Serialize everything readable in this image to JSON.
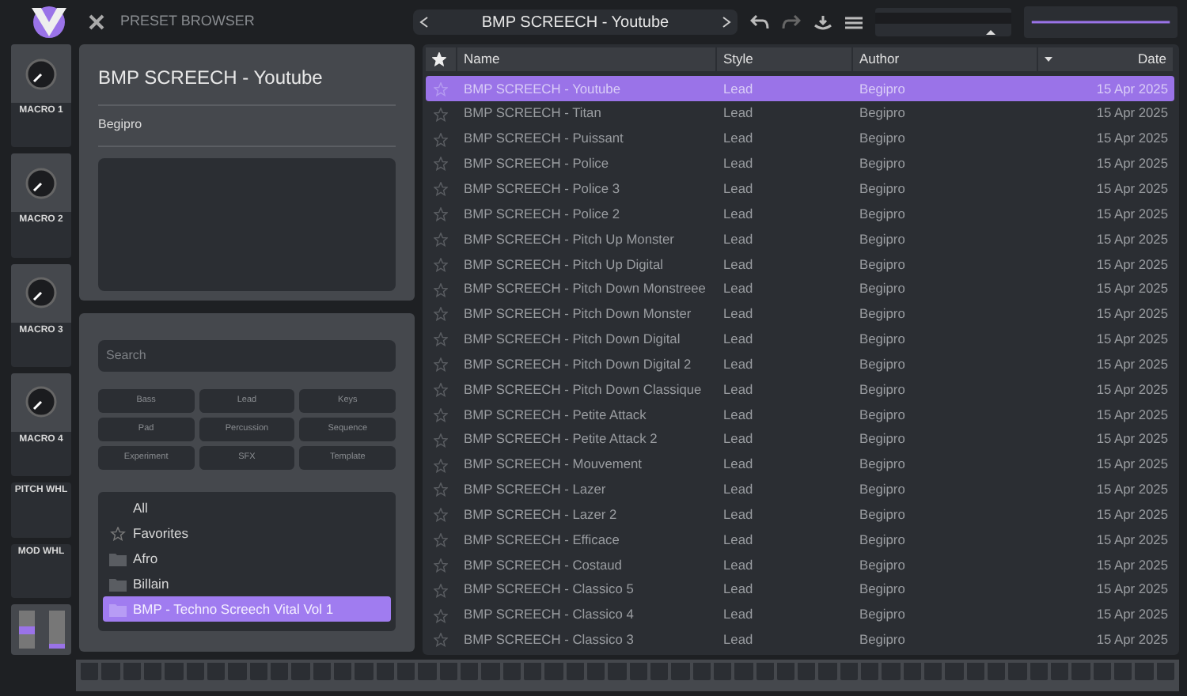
{
  "top_bar": {
    "title": "PRESET BROWSER",
    "preset_name": "BMP SCREECH - Youtube"
  },
  "macros": [
    {
      "label": "MACRO 1"
    },
    {
      "label": "MACRO 2"
    },
    {
      "label": "MACRO 3"
    },
    {
      "label": "MACRO 4"
    }
  ],
  "wheels": [
    {
      "label": "PITCH WHL"
    },
    {
      "label": "MOD WHL"
    }
  ],
  "preset_info": {
    "name": "BMP SCREECH - Youtube",
    "author": "Begipro"
  },
  "filters": {
    "search": {
      "placeholder": "Search"
    },
    "tags": [
      {
        "label": "Bass",
        "selected": false
      },
      {
        "label": "Lead",
        "selected": false
      },
      {
        "label": "Keys",
        "selected": false
      },
      {
        "label": "Pad",
        "selected": false
      },
      {
        "label": "Percussion",
        "selected": false
      },
      {
        "label": "Sequence",
        "selected": false
      },
      {
        "label": "Experiment",
        "selected": false
      },
      {
        "label": "SFX",
        "selected": false
      },
      {
        "label": "Template",
        "selected": false
      }
    ],
    "folders": [
      {
        "label": "All",
        "kind": "plain",
        "selected": false
      },
      {
        "label": "Favorites",
        "kind": "favorites",
        "selected": false
      },
      {
        "label": "Afro",
        "kind": "folder",
        "selected": false
      },
      {
        "label": "Billain",
        "kind": "folder",
        "selected": false
      },
      {
        "label": "BMP - Techno Screech Vital Vol 1",
        "kind": "folder",
        "selected": true
      }
    ]
  },
  "table": {
    "columns": [
      {
        "label": "Name",
        "sorted": false
      },
      {
        "label": "Style",
        "sorted": false
      },
      {
        "label": "Author",
        "sorted": false
      },
      {
        "label": "Date",
        "sorted": true
      }
    ],
    "rows": [
      {
        "name": "BMP SCREECH - Youtube",
        "style": "Lead",
        "author": "Begipro",
        "date": "15 Apr 2025",
        "favorite": false,
        "selected": true
      },
      {
        "name": "BMP SCREECH - Titan",
        "style": "Lead",
        "author": "Begipro",
        "date": "15 Apr 2025",
        "favorite": false,
        "selected": false
      },
      {
        "name": "BMP SCREECH - Puissant",
        "style": "Lead",
        "author": "Begipro",
        "date": "15 Apr 2025",
        "favorite": false,
        "selected": false
      },
      {
        "name": "BMP SCREECH - Police",
        "style": "Lead",
        "author": "Begipro",
        "date": "15 Apr 2025",
        "favorite": false,
        "selected": false
      },
      {
        "name": "BMP SCREECH - Police 3",
        "style": "Lead",
        "author": "Begipro",
        "date": "15 Apr 2025",
        "favorite": false,
        "selected": false
      },
      {
        "name": "BMP SCREECH - Police 2",
        "style": "Lead",
        "author": "Begipro",
        "date": "15 Apr 2025",
        "favorite": false,
        "selected": false
      },
      {
        "name": "BMP SCREECH - Pitch Up Monster",
        "style": "Lead",
        "author": "Begipro",
        "date": "15 Apr 2025",
        "favorite": false,
        "selected": false
      },
      {
        "name": "BMP SCREECH - Pitch Up Digital",
        "style": "Lead",
        "author": "Begipro",
        "date": "15 Apr 2025",
        "favorite": false,
        "selected": false
      },
      {
        "name": "BMP SCREECH - Pitch Down Monstreee",
        "style": "Lead",
        "author": "Begipro",
        "date": "15 Apr 2025",
        "favorite": false,
        "selected": false
      },
      {
        "name": "BMP SCREECH - Pitch Down Monster",
        "style": "Lead",
        "author": "Begipro",
        "date": "15 Apr 2025",
        "favorite": false,
        "selected": false
      },
      {
        "name": "BMP SCREECH - Pitch Down Digital",
        "style": "Lead",
        "author": "Begipro",
        "date": "15 Apr 2025",
        "favorite": false,
        "selected": false
      },
      {
        "name": "BMP SCREECH - Pitch Down Digital 2",
        "style": "Lead",
        "author": "Begipro",
        "date": "15 Apr 2025",
        "favorite": false,
        "selected": false
      },
      {
        "name": "BMP SCREECH - Pitch Down Classique",
        "style": "Lead",
        "author": "Begipro",
        "date": "15 Apr 2025",
        "favorite": false,
        "selected": false
      },
      {
        "name": "BMP SCREECH - Petite Attack",
        "style": "Lead",
        "author": "Begipro",
        "date": "15 Apr 2025",
        "favorite": false,
        "selected": false
      },
      {
        "name": "BMP SCREECH - Petite Attack 2",
        "style": "Lead",
        "author": "Begipro",
        "date": "15 Apr 2025",
        "favorite": false,
        "selected": false
      },
      {
        "name": "BMP SCREECH - Mouvement",
        "style": "Lead",
        "author": "Begipro",
        "date": "15 Apr 2025",
        "favorite": false,
        "selected": false
      },
      {
        "name": "BMP SCREECH - Lazer",
        "style": "Lead",
        "author": "Begipro",
        "date": "15 Apr 2025",
        "favorite": false,
        "selected": false
      },
      {
        "name": "BMP SCREECH - Lazer 2",
        "style": "Lead",
        "author": "Begipro",
        "date": "15 Apr 2025",
        "favorite": false,
        "selected": false
      },
      {
        "name": "BMP SCREECH - Efficace",
        "style": "Lead",
        "author": "Begipro",
        "date": "15 Apr 2025",
        "favorite": false,
        "selected": false
      },
      {
        "name": "BMP SCREECH - Costaud",
        "style": "Lead",
        "author": "Begipro",
        "date": "15 Apr 2025",
        "favorite": false,
        "selected": false
      },
      {
        "name": "BMP SCREECH - Classico 5",
        "style": "Lead",
        "author": "Begipro",
        "date": "15 Apr 2025",
        "favorite": false,
        "selected": false
      },
      {
        "name": "BMP SCREECH - Classico 4",
        "style": "Lead",
        "author": "Begipro",
        "date": "15 Apr 2025",
        "favorite": false,
        "selected": false
      },
      {
        "name": "BMP SCREECH - Classico 3",
        "style": "Lead",
        "author": "Begipro",
        "date": "15 Apr 2025",
        "favorite": false,
        "selected": false
      }
    ]
  }
}
